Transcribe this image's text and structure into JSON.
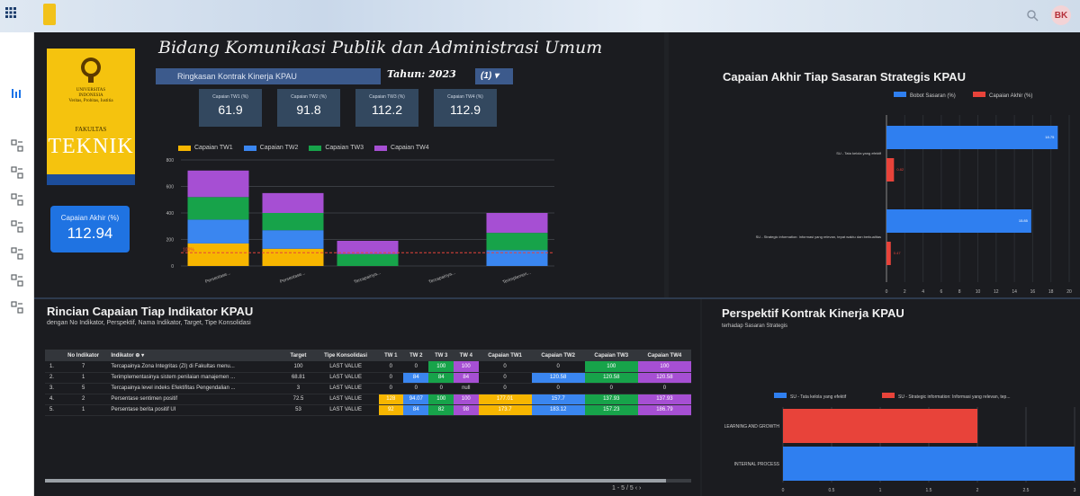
{
  "topbar": {
    "avatar_initials": "BK"
  },
  "brand": {
    "univ_line1": "UNIVERSITAS",
    "univ_line2": "INDONESIA",
    "univ_line3": "Veritas, Probitas, Iustitia",
    "fakultas": "FAKULTAS",
    "teknik": "TEKNIK"
  },
  "header": {
    "title": "Bidang Komunikasi Publik dan Administrasi Umum",
    "ringkasan": "Ringkasan Kontrak Kinerja KPAU",
    "tahun_label": "Tahun: 2023",
    "tahun_dropdown": "(1) ▾"
  },
  "capaian_akhir": {
    "label": "Capaian Akhir (%)",
    "value": "112.94"
  },
  "tw_cards": [
    {
      "label": "Capaian TW1 (%)",
      "value": "61.9"
    },
    {
      "label": "Capaian TW2 (%)",
      "value": "91.8"
    },
    {
      "label": "Capaian TW3 (%)",
      "value": "112.2"
    },
    {
      "label": "Capaian TW4 (%)",
      "value": "112.9"
    }
  ],
  "colors": {
    "tw1": "#f7b600",
    "tw2": "#3a86f0",
    "tw3": "#17a34a",
    "tw4": "#a64fd3",
    "bobot": "#2f7ff0",
    "capaian": "#e8433a",
    "accent": "#1f73e2"
  },
  "chart_data": [
    {
      "type": "bar",
      "stacked": true,
      "categories": [
        "Persentase...",
        "Persentase...",
        "Tercapainya...",
        "Tercapainya...",
        "Terimplemen..."
      ],
      "series": [
        {
          "name": "Capaian TW1",
          "values": [
            170,
            130,
            0,
            0,
            0
          ]
        },
        {
          "name": "Capaian TW2",
          "values": [
            180,
            140,
            0,
            0,
            120
          ]
        },
        {
          "name": "Capaian TW3",
          "values": [
            170,
            130,
            90,
            0,
            130
          ]
        },
        {
          "name": "Capaian TW4",
          "values": [
            200,
            150,
            100,
            0,
            150
          ]
        }
      ],
      "ylim": [
        0,
        800
      ],
      "yticks": [
        "0",
        "200",
        "400",
        "600",
        "800"
      ],
      "reference_line": {
        "value": 100,
        "label": "100%"
      },
      "legend": "top"
    },
    {
      "type": "bar",
      "orientation": "horizontal",
      "title": "Capaian Akhir Tiap Sasaran Strategis KPAU",
      "categories": [
        "SU - Tata kelola yang efektif",
        "SU - Strategic information: Informasi yang relevan, tepat waktu dan berkualitas"
      ],
      "series": [
        {
          "name": "Bobot Sasaran (%)",
          "values": [
            18.75,
            15.85
          ]
        },
        {
          "name": "Capaian Akhir (%)",
          "values": [
            0.82,
            0.47
          ]
        }
      ],
      "xlim": [
        0,
        20
      ],
      "xticks": [
        "0",
        "2",
        "4",
        "6",
        "8",
        "10",
        "12",
        "14",
        "16",
        "18",
        "20"
      ],
      "legend": "top"
    },
    {
      "type": "bar",
      "orientation": "horizontal",
      "title": "Perspektif Kontrak Kinerja KPAU",
      "subtitle": "terhadap Sasaran Strategis",
      "categories": [
        "LEARNING AND GROWTH",
        "INTERNAL PROCESS"
      ],
      "series": [
        {
          "name": "SU - Tata kelola yang efektif",
          "values": [
            0,
            3
          ]
        },
        {
          "name": "SU - Strategic information: Informasi yang relevan, tep...",
          "values": [
            2,
            0
          ]
        }
      ],
      "xlim": [
        0,
        3
      ],
      "xticks": [
        "0",
        "0.5",
        "1",
        "1.5",
        "2",
        "2.5",
        "3"
      ],
      "legend": "top"
    }
  ],
  "table": {
    "title": "Rincian Capaian Tiap Indikator KPAU",
    "subtitle": "dengan No Indikator, Perspektif, Nama Indikator, Target, Tipe Konsolidasi",
    "headers": [
      "",
      "No Indikator",
      "Indikator ⊕ ▾",
      "Target",
      "Tipe Konsolidasi",
      "TW 1",
      "TW 2",
      "TW 3",
      "TW 4",
      "Capaian TW1",
      "Capaian TW2",
      "Capaian TW3",
      "Capaian TW4"
    ],
    "rows": [
      [
        "1.",
        "7",
        "Tercapainya Zona Integritas (ZI) di Fakultas menu...",
        "100",
        "LAST VALUE",
        "0",
        "0",
        "100",
        "100",
        "0",
        "0",
        "100",
        "100"
      ],
      [
        "2.",
        "1",
        "Terimplementasinya sistem penilaian manajemen ...",
        "68.81",
        "LAST VALUE",
        "0",
        "84",
        "84",
        "84",
        "0",
        "120.58",
        "120.58",
        "120.58"
      ],
      [
        "3.",
        "5",
        "Tercapainya level indeks Efektifitas Pengendalian ...",
        "3",
        "LAST VALUE",
        "0",
        "0",
        "0",
        "null",
        "0",
        "0",
        "0",
        "0"
      ],
      [
        "4.",
        "2",
        "Persentase sentimen positif",
        "72.5",
        "LAST VALUE",
        "128",
        "94.07",
        "100",
        "100",
        "177.01",
        "157.7",
        "137.93",
        "137.93"
      ],
      [
        "5.",
        "1",
        "Persentase berita positif UI",
        "53",
        "LAST VALUE",
        "92",
        "84",
        "82",
        "98",
        "173.7",
        "183.12",
        "157.23",
        "186.79"
      ]
    ],
    "cell_colors": [
      [
        null,
        null,
        null,
        null,
        null,
        null,
        null,
        "#17a34a",
        "#a64fd3",
        null,
        null,
        "#17a34a",
        "#a64fd3"
      ],
      [
        null,
        null,
        null,
        null,
        null,
        null,
        "#3a86f0",
        "#17a34a",
        "#a64fd3",
        null,
        "#3a86f0",
        "#17a34a",
        "#a64fd3"
      ],
      [
        null,
        null,
        null,
        null,
        null,
        null,
        null,
        null,
        null,
        null,
        null,
        null,
        null
      ],
      [
        null,
        null,
        null,
        null,
        null,
        "#f7b600",
        "#3a86f0",
        "#17a34a",
        "#a64fd3",
        "#f7b600",
        "#3a86f0",
        "#17a34a",
        "#a64fd3"
      ],
      [
        null,
        null,
        null,
        null,
        null,
        "#f7b600",
        "#3a86f0",
        "#17a34a",
        "#a64fd3",
        "#f7b600",
        "#3a86f0",
        "#17a34a",
        "#a64fd3"
      ]
    ],
    "pager": "1 - 5 / 5"
  }
}
